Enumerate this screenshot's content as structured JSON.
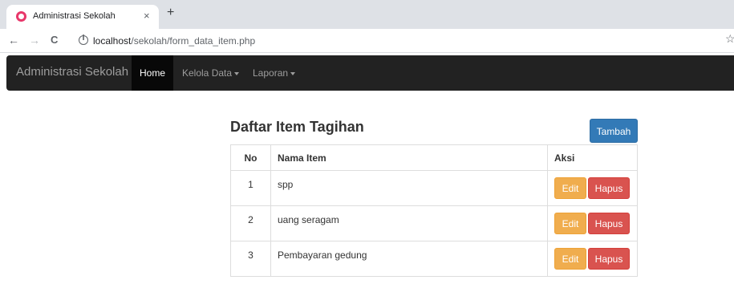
{
  "browser": {
    "tab_title": "Administrasi Sekolah",
    "tab_close": "×",
    "new_tab": "+",
    "url_host": "localhost",
    "url_path": "/sekolah/form_data_item.php",
    "back": "←",
    "forward": "→",
    "reload": "C",
    "star": "☆"
  },
  "navbar": {
    "brand": "Administrasi Sekolah",
    "items": [
      {
        "label": "Home",
        "active": true
      },
      {
        "label": "Kelola Data",
        "dropdown": true
      },
      {
        "label": "Laporan",
        "dropdown": true
      }
    ]
  },
  "content": {
    "heading": "Daftar Item Tagihan",
    "add_button": "Tambah",
    "table": {
      "headers": [
        "No",
        "Nama Item",
        "Aksi"
      ],
      "rows": [
        {
          "no": "1",
          "name": "spp",
          "edit": "Edit",
          "delete": "Hapus"
        },
        {
          "no": "2",
          "name": "uang seragam",
          "edit": "Edit",
          "delete": "Hapus"
        },
        {
          "no": "3",
          "name": "Pembayaran gedung",
          "edit": "Edit",
          "delete": "Hapus"
        }
      ]
    }
  },
  "colors": {
    "navbar_bg": "#222222",
    "primary": "#337ab7",
    "warning": "#f0ad4e",
    "danger": "#d9534f"
  }
}
